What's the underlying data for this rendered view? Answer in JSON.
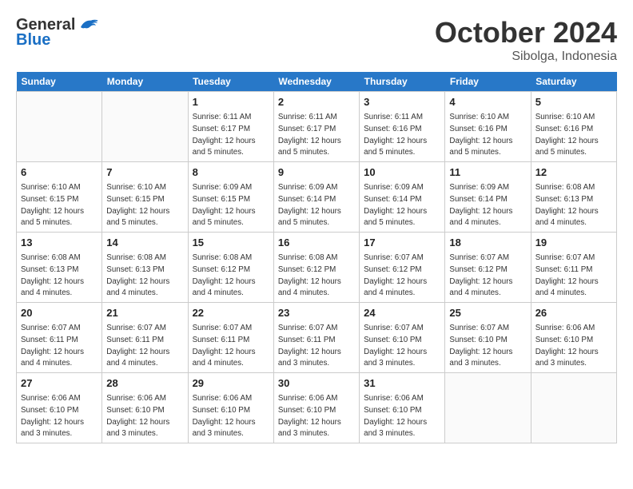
{
  "header": {
    "logo_general": "General",
    "logo_blue": "Blue",
    "month": "October 2024",
    "location": "Sibolga, Indonesia"
  },
  "weekdays": [
    "Sunday",
    "Monday",
    "Tuesday",
    "Wednesday",
    "Thursday",
    "Friday",
    "Saturday"
  ],
  "weeks": [
    [
      {
        "day": "",
        "info": ""
      },
      {
        "day": "",
        "info": ""
      },
      {
        "day": "1",
        "info": "Sunrise: 6:11 AM\nSunset: 6:17 PM\nDaylight: 12 hours and 5 minutes."
      },
      {
        "day": "2",
        "info": "Sunrise: 6:11 AM\nSunset: 6:17 PM\nDaylight: 12 hours and 5 minutes."
      },
      {
        "day": "3",
        "info": "Sunrise: 6:11 AM\nSunset: 6:16 PM\nDaylight: 12 hours and 5 minutes."
      },
      {
        "day": "4",
        "info": "Sunrise: 6:10 AM\nSunset: 6:16 PM\nDaylight: 12 hours and 5 minutes."
      },
      {
        "day": "5",
        "info": "Sunrise: 6:10 AM\nSunset: 6:16 PM\nDaylight: 12 hours and 5 minutes."
      }
    ],
    [
      {
        "day": "6",
        "info": "Sunrise: 6:10 AM\nSunset: 6:15 PM\nDaylight: 12 hours and 5 minutes."
      },
      {
        "day": "7",
        "info": "Sunrise: 6:10 AM\nSunset: 6:15 PM\nDaylight: 12 hours and 5 minutes."
      },
      {
        "day": "8",
        "info": "Sunrise: 6:09 AM\nSunset: 6:15 PM\nDaylight: 12 hours and 5 minutes."
      },
      {
        "day": "9",
        "info": "Sunrise: 6:09 AM\nSunset: 6:14 PM\nDaylight: 12 hours and 5 minutes."
      },
      {
        "day": "10",
        "info": "Sunrise: 6:09 AM\nSunset: 6:14 PM\nDaylight: 12 hours and 5 minutes."
      },
      {
        "day": "11",
        "info": "Sunrise: 6:09 AM\nSunset: 6:14 PM\nDaylight: 12 hours and 4 minutes."
      },
      {
        "day": "12",
        "info": "Sunrise: 6:08 AM\nSunset: 6:13 PM\nDaylight: 12 hours and 4 minutes."
      }
    ],
    [
      {
        "day": "13",
        "info": "Sunrise: 6:08 AM\nSunset: 6:13 PM\nDaylight: 12 hours and 4 minutes."
      },
      {
        "day": "14",
        "info": "Sunrise: 6:08 AM\nSunset: 6:13 PM\nDaylight: 12 hours and 4 minutes."
      },
      {
        "day": "15",
        "info": "Sunrise: 6:08 AM\nSunset: 6:12 PM\nDaylight: 12 hours and 4 minutes."
      },
      {
        "day": "16",
        "info": "Sunrise: 6:08 AM\nSunset: 6:12 PM\nDaylight: 12 hours and 4 minutes."
      },
      {
        "day": "17",
        "info": "Sunrise: 6:07 AM\nSunset: 6:12 PM\nDaylight: 12 hours and 4 minutes."
      },
      {
        "day": "18",
        "info": "Sunrise: 6:07 AM\nSunset: 6:12 PM\nDaylight: 12 hours and 4 minutes."
      },
      {
        "day": "19",
        "info": "Sunrise: 6:07 AM\nSunset: 6:11 PM\nDaylight: 12 hours and 4 minutes."
      }
    ],
    [
      {
        "day": "20",
        "info": "Sunrise: 6:07 AM\nSunset: 6:11 PM\nDaylight: 12 hours and 4 minutes."
      },
      {
        "day": "21",
        "info": "Sunrise: 6:07 AM\nSunset: 6:11 PM\nDaylight: 12 hours and 4 minutes."
      },
      {
        "day": "22",
        "info": "Sunrise: 6:07 AM\nSunset: 6:11 PM\nDaylight: 12 hours and 4 minutes."
      },
      {
        "day": "23",
        "info": "Sunrise: 6:07 AM\nSunset: 6:11 PM\nDaylight: 12 hours and 3 minutes."
      },
      {
        "day": "24",
        "info": "Sunrise: 6:07 AM\nSunset: 6:10 PM\nDaylight: 12 hours and 3 minutes."
      },
      {
        "day": "25",
        "info": "Sunrise: 6:07 AM\nSunset: 6:10 PM\nDaylight: 12 hours and 3 minutes."
      },
      {
        "day": "26",
        "info": "Sunrise: 6:06 AM\nSunset: 6:10 PM\nDaylight: 12 hours and 3 minutes."
      }
    ],
    [
      {
        "day": "27",
        "info": "Sunrise: 6:06 AM\nSunset: 6:10 PM\nDaylight: 12 hours and 3 minutes."
      },
      {
        "day": "28",
        "info": "Sunrise: 6:06 AM\nSunset: 6:10 PM\nDaylight: 12 hours and 3 minutes."
      },
      {
        "day": "29",
        "info": "Sunrise: 6:06 AM\nSunset: 6:10 PM\nDaylight: 12 hours and 3 minutes."
      },
      {
        "day": "30",
        "info": "Sunrise: 6:06 AM\nSunset: 6:10 PM\nDaylight: 12 hours and 3 minutes."
      },
      {
        "day": "31",
        "info": "Sunrise: 6:06 AM\nSunset: 6:10 PM\nDaylight: 12 hours and 3 minutes."
      },
      {
        "day": "",
        "info": ""
      },
      {
        "day": "",
        "info": ""
      }
    ]
  ]
}
